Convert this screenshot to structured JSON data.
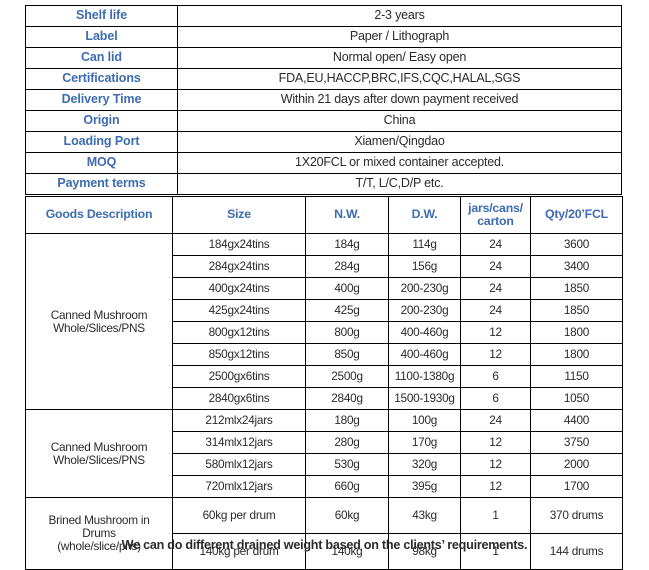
{
  "spec_rows": [
    {
      "key": "Shelf life",
      "value": "2-3 years"
    },
    {
      "key": "Label",
      "value": "Paper / Lithograph"
    },
    {
      "key": "Can lid",
      "value": "Normal open/ Easy open"
    },
    {
      "key": "Certifications",
      "value": "FDA,EU,HACCP,BRC,IFS,CQC,HALAL,SGS"
    },
    {
      "key": "Delivery Time",
      "value": "Within 21 days after down payment received"
    },
    {
      "key": "Origin",
      "value": "China"
    },
    {
      "key": "Loading Port",
      "value": "Xiamen/Qingdao"
    },
    {
      "key": "MOQ",
      "value": "1X20FCL or mixed container accepted."
    },
    {
      "key": "Payment terms",
      "value": "T/T, L/C,D/P etc."
    }
  ],
  "goods_table": {
    "headers": {
      "description": "Goods Description",
      "size": "Size",
      "nw": "N.W.",
      "dw": "D.W.",
      "jars_line1": "jars/cans/",
      "jars_line2": "carton",
      "qty": "Qty/20’FCL"
    },
    "groups": [
      {
        "label_line1": "Canned Mushroom",
        "label_line2": "Whole/Slices/PNS",
        "rows": [
          {
            "size": "184gx24tins",
            "nw": "184g",
            "dw": "114g",
            "jars": "24",
            "qty": "3600"
          },
          {
            "size": "284gx24tins",
            "nw": "284g",
            "dw": "156g",
            "jars": "24",
            "qty": "3400"
          },
          {
            "size": "400gx24tins",
            "nw": "400g",
            "dw": "200-230g",
            "jars": "24",
            "qty": "1850"
          },
          {
            "size": "425gx24tins",
            "nw": "425g",
            "dw": "200-230g",
            "jars": "24",
            "qty": "1850"
          },
          {
            "size": "800gx12tins",
            "nw": "800g",
            "dw": "400-460g",
            "jars": "12",
            "qty": "1800"
          },
          {
            "size": "850gx12tins",
            "nw": "850g",
            "dw": "400-460g",
            "jars": "12",
            "qty": "1800"
          },
          {
            "size": "2500gx6tins",
            "nw": "2500g",
            "dw": "1100-1380g",
            "jars": "6",
            "qty": "1150"
          },
          {
            "size": "2840gx6tins",
            "nw": "2840g",
            "dw": "1500-1930g",
            "jars": "6",
            "qty": "1050"
          }
        ]
      },
      {
        "label_line1": "Canned Mushroom",
        "label_line2": "Whole/Slices/PNS",
        "rows": [
          {
            "size": "212mlx24jars",
            "nw": "180g",
            "dw": "100g",
            "jars": "24",
            "qty": "4400"
          },
          {
            "size": "314mlx12jars",
            "nw": "280g",
            "dw": "170g",
            "jars": "12",
            "qty": "3750"
          },
          {
            "size": "580mlx12jars",
            "nw": "530g",
            "dw": "320g",
            "jars": "12",
            "qty": "2000"
          },
          {
            "size": "720mlx12jars",
            "nw": "660g",
            "dw": "395g",
            "jars": "12",
            "qty": "1700"
          }
        ]
      },
      {
        "label_line1": "Brined Mushroom in",
        "label_line2": "Drums",
        "label_line3": "(whole/slice/pns)",
        "rows": [
          {
            "size": "60kg per drum",
            "nw": "60kg",
            "dw": "43kg",
            "jars": "1",
            "qty": "370 drums"
          },
          {
            "size": "140kg per drum",
            "nw": "140kg",
            "dw": "98kg",
            "jars": "1",
            "qty": "144 drums"
          }
        ]
      }
    ]
  },
  "footer_note": "We can do different drained weight based on the clients’ requirements.",
  "colors": {
    "header_blue": "#3d6cb0",
    "body_text": "#2b2b2b",
    "border": "#000000",
    "background": "#ffffff"
  }
}
